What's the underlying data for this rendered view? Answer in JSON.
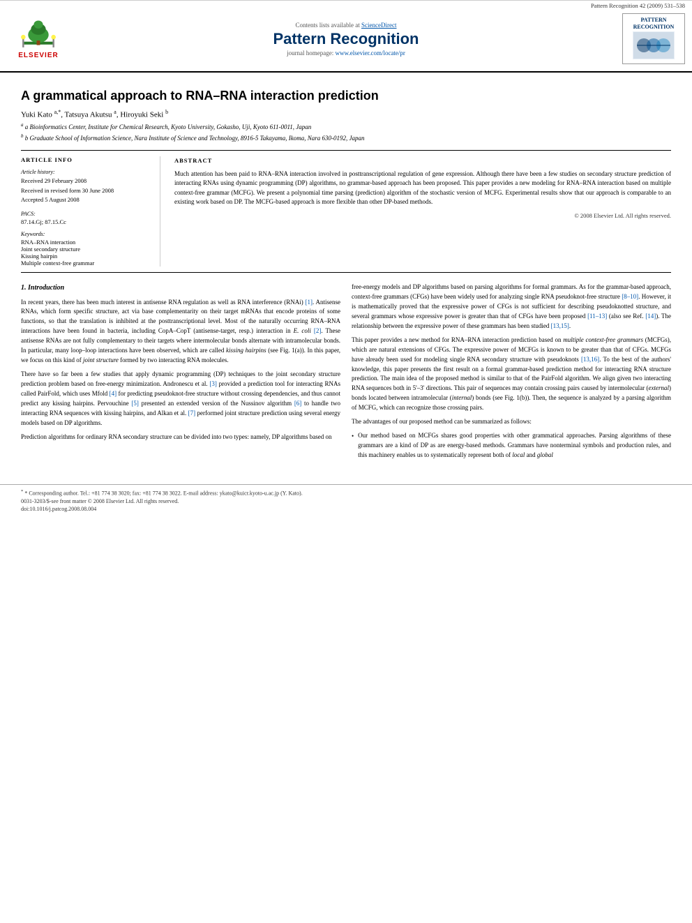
{
  "meta": {
    "journal_info": "Pattern Recognition 42 (2009) 531–538",
    "contents_line": "Contents lists available at",
    "science_direct": "ScienceDirect",
    "journal_title": "Pattern Recognition",
    "journal_homepage_label": "journal homepage:",
    "journal_homepage_url": "www.elsevier.com/locate/pr",
    "elsevier_label": "ELSEVIER",
    "pattern_logo_text": "PATTERN\nRECOGNITION"
  },
  "article": {
    "title": "A grammatical approach to RNA–RNA interaction prediction",
    "authors": "Yuki Kato a,*, Tatsuya Akutsu a, Hiroyuki Seki b",
    "author_notes": "* Corresponding author. Tel.: +81 774 38 3020; fax: +81 774 38 3022. E-mail address: ykato@kuicr.kyoto-u.ac.jp (Y. Kato).",
    "affiliations": [
      "a Bioinformatics Center, Institute for Chemical Research, Kyoto University, Gokasho, Uji, Kyoto 611-0011, Japan",
      "b Graduate School of Information Science, Nara Institute of Science and Technology, 8916-5 Takayama, Ikoma, Nara 630-0192, Japan"
    ]
  },
  "article_info": {
    "heading": "ARTICLE INFO",
    "history_label": "Article history:",
    "received": "Received 29 February 2008",
    "revised": "Received in revised form 30 June 2008",
    "accepted": "Accepted 5 August 2008",
    "pacs_label": "PACS:",
    "pacs_values": "87.14.Gj; 87.15.Cc",
    "keywords_label": "Keywords:",
    "keywords": [
      "RNA–RNA interaction",
      "Joint secondary structure",
      "Kissing hairpin",
      "Multiple context-free grammar"
    ]
  },
  "abstract": {
    "heading": "ABSTRACT",
    "text": "Much attention has been paid to RNA–RNA interaction involved in posttranscriptional regulation of gene expression. Although there have been a few studies on secondary structure prediction of interacting RNAs using dynamic programming (DP) algorithms, no grammar-based approach has been proposed. This paper provides a new modeling for RNA–RNA interaction based on multiple context-free grammar (MCFG). We present a polynomial time parsing (prediction) algorithm of the stochastic version of MCFG. Experimental results show that our approach is comparable to an existing work based on DP. The MCFG-based approach is more flexible than other DP-based methods.",
    "copyright": "© 2008 Elsevier Ltd. All rights reserved."
  },
  "sections": {
    "intro": {
      "heading": "1.  Introduction",
      "paragraphs": [
        "In recent years, there has been much interest in antisense RNA regulation as well as RNA interference (RNAi) [1]. Antisense RNAs, which form specific structure, act via base complementarity on their target mRNAs that encode proteins of some functions, so that the translation is inhibited at the posttranscriptional level. Most of the naturally occurring RNA–RNA interactions have been found in bacteria, including CopA–CopT (antisense-target, resp.) interaction in E. coli [2]. These antisense RNAs are not fully complementary to their targets where intermolecular bonds alternate with intramolecular bonds. In particular, many loop–loop interactions have been observed, which are called kissing hairpins (see Fig. 1(a)). In this paper, we focus on this kind of joint structure formed by two interacting RNA molecules.",
        "There have so far been a few studies that apply dynamic programming (DP) techniques to the joint secondary structure prediction problem based on free-energy minimization. Andronescu et al. [3] provided a prediction tool for interacting RNAs called PairFold, which uses Mfold [4] for predicting pseudoknot-free structure without crossing dependencies, and thus cannot predict any kissing hairpins. Pervouchine [5] presented an extended version of the Nussinov algorithm [6] to handle two interacting RNA sequences with kissing hairpins, and Alkan et al. [7] performed joint structure prediction using several energy models based on DP algorithms.",
        "Prediction algorithms for ordinary RNA secondary structure can be divided into two types: namely, DP algorithms based on"
      ]
    },
    "right_col": {
      "paragraphs": [
        "free-energy models and DP algorithms based on parsing algorithms for formal grammars. As for the grammar-based approach, context-free grammars (CFGs) have been widely used for analyzing single RNA pseudoknot-free structure [8–10]. However, it is mathematically proved that the expressive power of CFGs is not sufficient for describing pseudoknotted structure, and several grammars whose expressive power is greater than that of CFGs have been proposed [11–13] (also see Ref. [14]). The relationship between the expressive power of these grammars has been studied [13,15].",
        "This paper provides a new method for RNA–RNA interaction prediction based on multiple context-free grammars (MCFGs), which are natural extensions of CFGs. The expressive power of MCFGs is known to be greater than that of CFGs. MCFGs have already been used for modeling single RNA secondary structure with pseudoknots [13,16]. To the best of the authors' knowledge, this paper presents the first result on a formal grammar-based prediction method for interacting RNA structure prediction. The main idea of the proposed method is similar to that of the PairFold algorithm. We align given two interacting RNA sequences both in 5'–3' directions. This pair of sequences may contain crossing pairs caused by intermolecular (external) bonds located between intramolecular (internal) bonds (see Fig. 1(b)). Then, the sequence is analyzed by a parsing algorithm of MCFG, which can recognize those crossing pairs.",
        "The advantages of our proposed method can be summarized as follows:"
      ],
      "bullet": {
        "intro": "• Our method based on MCFGs shares good properties with other grammatical approaches. Parsing algorithms of these grammars are a kind of DP as are energy-based methods. Grammars have nonterminal symbols and production rules, and this machinery enables us to systematically represent both of local and global"
      }
    }
  },
  "footer": {
    "copyright_line": "0031-3203/$-see front matter © 2008 Elsevier Ltd. All rights reserved.",
    "doi": "doi:10.1016/j.patcog.2008.08.004"
  }
}
